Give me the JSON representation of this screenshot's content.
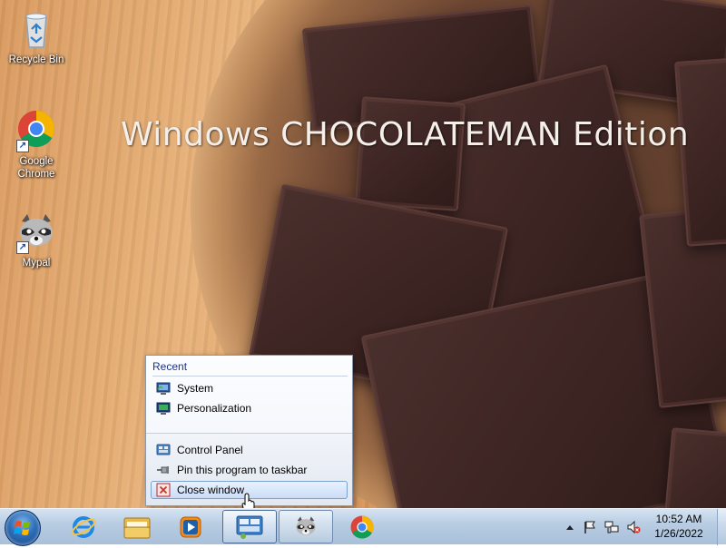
{
  "desktop": {
    "watermark": "Windows CHOCOLATEMAN Edition",
    "icons": [
      {
        "label": "Recycle Bin",
        "icon": "recycle-bin-icon"
      },
      {
        "label": "Google Chrome",
        "icon": "chrome-icon"
      },
      {
        "label": "Mypal",
        "icon": "raccoon-icon"
      }
    ]
  },
  "jumplist": {
    "header": "Recent",
    "recent": [
      {
        "label": "System",
        "icon": "system-icon"
      },
      {
        "label": "Personalization",
        "icon": "personalization-icon"
      }
    ],
    "tasks": [
      {
        "label": "Control Panel",
        "icon": "control-panel-icon"
      },
      {
        "label": "Pin this program to taskbar",
        "icon": "pin-icon"
      },
      {
        "label": "Close window",
        "icon": "close-window-icon"
      }
    ]
  },
  "taskbar": {
    "start": "start-orb-icon",
    "pinned": [
      "internet-explorer-icon",
      "file-explorer-icon",
      "media-player-icon",
      "control-panel-icon",
      "raccoon-icon",
      "chrome-icon"
    ],
    "tray": {
      "time": "10:52 AM",
      "date": "1/26/2022",
      "icons": [
        "show-hidden-icons-icon",
        "action-center-flag-icon",
        "network-icon",
        "volume-muted-icon"
      ]
    }
  },
  "colors": {
    "jumplist_header": "#1e3287",
    "taskbar_top": "#d6e4f2",
    "hover_border": "#7da2ce"
  }
}
